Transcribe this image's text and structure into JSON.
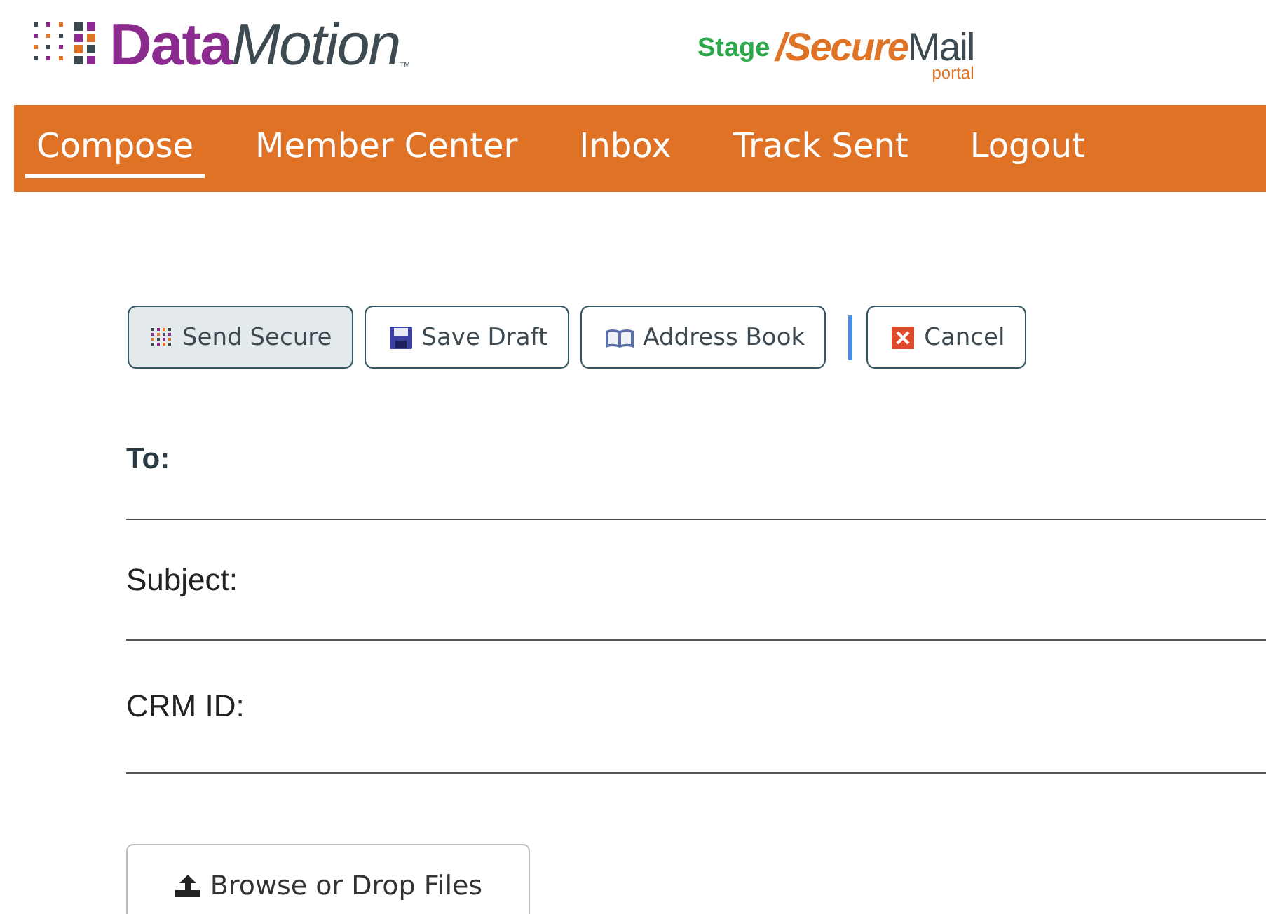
{
  "brand": {
    "name_a": "Data",
    "name_b": "Motion",
    "tm": "TM",
    "env": "Stage",
    "product_a": "/Secure",
    "product_b": "Mail",
    "product_sub": "portal"
  },
  "nav": [
    {
      "label": "Compose",
      "selected": true
    },
    {
      "label": "Member Center",
      "selected": false
    },
    {
      "label": "Inbox",
      "selected": false
    },
    {
      "label": "Track Sent",
      "selected": false
    },
    {
      "label": "Logout",
      "selected": false
    }
  ],
  "toolbar": [
    {
      "label": "Send Secure",
      "kind": "send",
      "highlighted": true,
      "divider_before": false
    },
    {
      "label": "Save Draft",
      "kind": "save",
      "highlighted": false,
      "divider_before": false
    },
    {
      "label": "Address Book",
      "kind": "book",
      "highlighted": false,
      "divider_before": false
    },
    {
      "label": "Cancel",
      "kind": "cancel",
      "highlighted": false,
      "divider_before": true
    }
  ],
  "fields": [
    {
      "label": "To:",
      "bold": true
    },
    {
      "label": "Subject:",
      "bold": false
    },
    {
      "label": "CRM ID:",
      "bold": false
    }
  ],
  "upload_button": {
    "label": "Browse or Drop Files"
  }
}
